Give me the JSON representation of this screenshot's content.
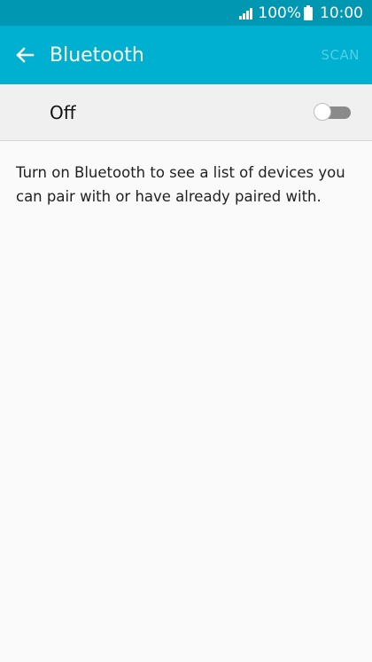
{
  "status_bar": {
    "battery_percent": "100%",
    "time": "10:00",
    "signal_icon": "signal-icon",
    "battery_icon": "battery-icon"
  },
  "app_bar": {
    "back_icon": "arrow-left-icon",
    "title": "Bluetooth",
    "scan_label": "SCAN",
    "scan_enabled": false
  },
  "toggle": {
    "label": "Off",
    "state": "off"
  },
  "description": "Turn on Bluetooth to see a list of devices you can pair with or have already paired with.",
  "colors": {
    "status_bar": "#0097b2",
    "app_bar": "#00b0d0",
    "background": "#fafafa"
  }
}
